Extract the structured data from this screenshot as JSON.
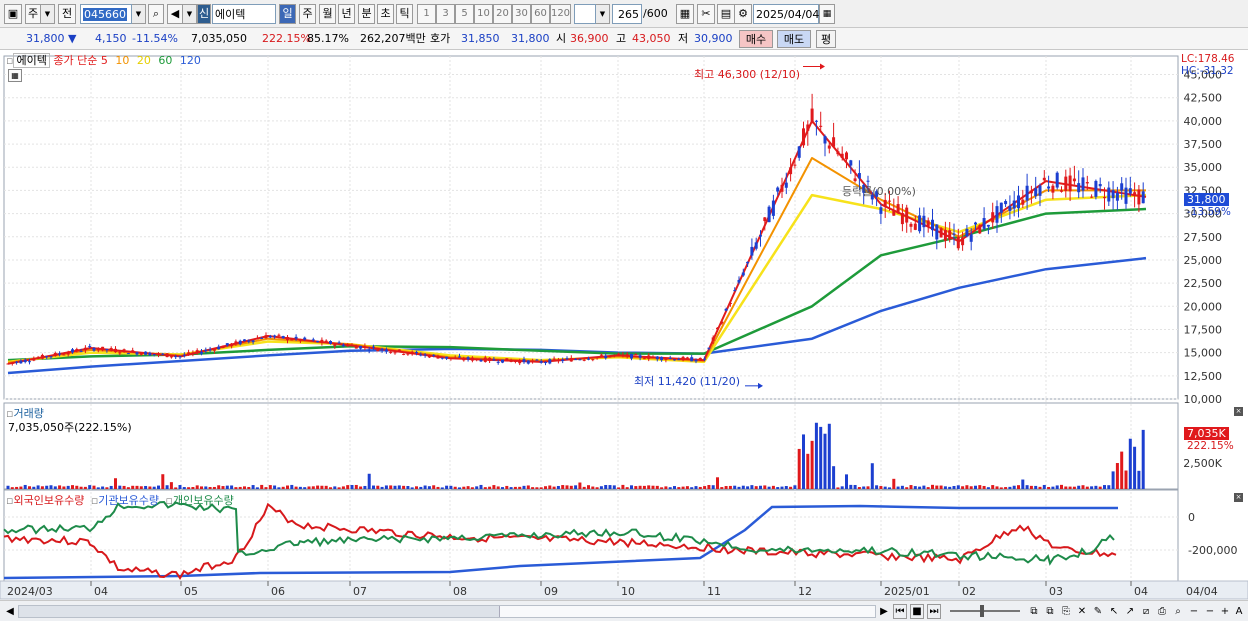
{
  "toolbar": {
    "mode_stock": "주",
    "prev_label": "전",
    "code": "045660",
    "badge_new": "신",
    "stock_name": "에이텍",
    "periods": [
      "일",
      "주",
      "월",
      "년",
      "분",
      "초",
      "틱"
    ],
    "intervals": [
      "1",
      "3",
      "5",
      "10",
      "20",
      "30",
      "60",
      "120"
    ],
    "count": "265",
    "count_max": "/600",
    "date": "2025/04/04"
  },
  "info": {
    "price": "31,800",
    "change": "4,150",
    "change_pct": "-11.54%",
    "volume": "7,035,050",
    "volume_ratio": "222.15%",
    "rate2": "85.17%",
    "amount": "262,207백만",
    "hoga_label": "호가",
    "hoga_sell": "31,850",
    "hoga_buy": "31,800",
    "open_label": "시",
    "open": "36,900",
    "high_label": "고",
    "high": "43,050",
    "low_label": "저",
    "low": "30,900",
    "buy_btn": "매수",
    "sell_btn": "매도",
    "eval_btn": "평"
  },
  "price_panel": {
    "stock_label": "에이텍",
    "legend_title": "종가 단순",
    "ma_labels": [
      "5",
      "10",
      "20",
      "60",
      "120"
    ],
    "lc": "LC:178.46",
    "hc": "HC:-31.32",
    "current": "31,800",
    "current_pct": "-13.59%",
    "max_annotation": "최고 46,300 (12/10)",
    "min_annotation": "최저 11,420 (11/20)",
    "rate_annotation": "등락률(0.00%)",
    "y_ticks": [
      "45,000",
      "42,500",
      "40,000",
      "37,500",
      "35,000",
      "32,500",
      "30,000",
      "27,500",
      "25,000",
      "22,500",
      "20,000",
      "17,500",
      "15,000",
      "12,500",
      "10,000"
    ]
  },
  "volume_panel": {
    "title": "거래량",
    "value": "7,035,050주(222.15%)",
    "current": "7,035K",
    "current_pct": "222.15%",
    "y_tick": "2,500K"
  },
  "holding_panel": {
    "series": [
      "외국인보유수량",
      "기관보유수량",
      "개인보유수량"
    ],
    "y_ticks": [
      "0",
      "-200,000"
    ]
  },
  "x_axis": {
    "labels": [
      "2024/03",
      "04",
      "05",
      "06",
      "07",
      "08",
      "09",
      "10",
      "11",
      "12",
      "2025/01",
      "02",
      "03",
      "04"
    ],
    "end_label": "04/04"
  },
  "colors": {
    "up": "#e0191c",
    "down": "#1c3fd0",
    "ma5": "#e11b1b",
    "ma10": "#f39200",
    "ma20": "#f7e21b",
    "ma60": "#1e9b3a",
    "ma120": "#2a5bd7"
  },
  "chart_data": {
    "type": "line",
    "x": [
      "2024-03",
      "2024-04",
      "2024-05",
      "2024-06",
      "2024-07",
      "2024-08",
      "2024-09",
      "2024-10",
      "2024-11",
      "2024-12",
      "2025-01",
      "2025-02",
      "2025-03",
      "2025-04"
    ],
    "series": [
      {
        "name": "5",
        "values": [
          13800,
          15500,
          14600,
          16800,
          15800,
          14400,
          14000,
          14700,
          14200,
          40000,
          31000,
          27000,
          33500,
          31800
        ]
      },
      {
        "name": "10",
        "values": [
          13900,
          15300,
          14700,
          16500,
          15900,
          14500,
          14100,
          14600,
          14100,
          36000,
          31500,
          27500,
          32500,
          32500
        ]
      },
      {
        "name": "20",
        "values": [
          14000,
          15000,
          14800,
          16200,
          15900,
          14700,
          14200,
          14500,
          14000,
          32000,
          30500,
          28000,
          31500,
          32000
        ]
      },
      {
        "name": "60",
        "values": [
          14200,
          14600,
          14800,
          15300,
          15700,
          15600,
          15200,
          14900,
          14900,
          20000,
          25500,
          27500,
          30000,
          30500
        ]
      },
      {
        "name": "120",
        "values": [
          12800,
          13500,
          14100,
          14700,
          15200,
          15400,
          15300,
          15000,
          14900,
          16500,
          19500,
          22000,
          24000,
          25200
        ]
      }
    ],
    "ylim": [
      10000,
      47000
    ],
    "y_scale_ticks": [
      10000,
      12500,
      15000,
      17500,
      20000,
      22500,
      25000,
      27500,
      30000,
      32500,
      35000,
      37500,
      40000,
      42500,
      45000
    ],
    "max": {
      "value": 46300,
      "date": "12/10"
    },
    "min": {
      "value": 11420,
      "date": "11/20"
    },
    "volume_ticks_k": [
      2500
    ]
  }
}
